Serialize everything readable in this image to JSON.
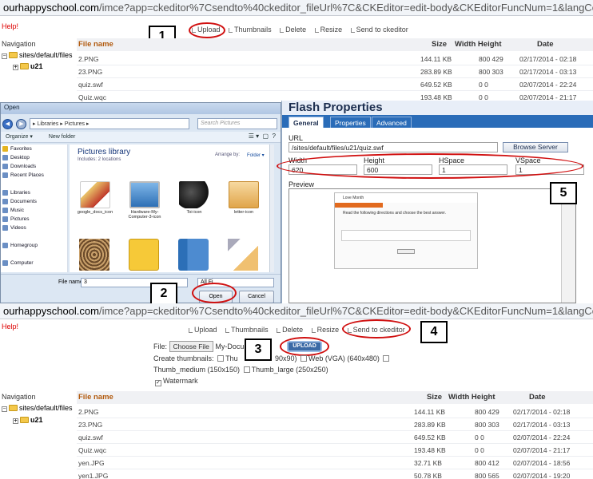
{
  "browser": {
    "host": "ourhappyschool.com",
    "path": "/imce?app=ckeditor%7Csendto%40ckeditor_fileUrl%7C&CKEditor=edit-body&CKEditorFuncNum=1&langCode=en",
    "path_partial": "/imce?app=c",
    "path_tail": "editor%7Csendto%40ckeditor_fileUrl%7C&CKEditor=edit-body&CKEditorFuncNum=1&langCode=en"
  },
  "help": "Help!",
  "toolbar": {
    "upload": "Upload",
    "thumbnails": "Thumbnails",
    "delete": "Delete",
    "resize": "Resize",
    "send": "Send to ckeditor"
  },
  "nav": {
    "title": "Navigation",
    "root": "sites/default/files",
    "sub": "u21"
  },
  "table": {
    "headers": {
      "name": "File name",
      "size": "Size",
      "dims": "Width Height",
      "date": "Date"
    },
    "rows_top": [
      {
        "name": "2.PNG",
        "size": "144.11 KB",
        "dims": "800 429",
        "date": "02/17/2014 - 02:18"
      },
      {
        "name": "23.PNG",
        "size": "283.89 KB",
        "dims": "800 303",
        "date": "02/17/2014 - 03:13"
      },
      {
        "name": "quiz.swf",
        "size": "649.52 KB",
        "dims": "0 0",
        "date": "02/07/2014 - 22:24"
      },
      {
        "name": "Quiz.wqc",
        "size": "193.48 KB",
        "dims": "0 0",
        "date": "02/07/2014 - 21:17"
      }
    ],
    "rows_bottom": [
      {
        "name": "2.PNG",
        "size": "144.11 KB",
        "dims": "800 429",
        "date": "02/17/2014 - 02:18"
      },
      {
        "name": "23.PNG",
        "size": "283.89 KB",
        "dims": "800 303",
        "date": "02/17/2014 - 03:13"
      },
      {
        "name": "quiz.swf",
        "size": "649.52 KB",
        "dims": "0 0",
        "date": "02/07/2014 - 22:24"
      },
      {
        "name": "Quiz.wqc",
        "size": "193.48 KB",
        "dims": "0 0",
        "date": "02/07/2014 - 21:17"
      },
      {
        "name": "yen.JPG",
        "size": "32.71 KB",
        "dims": "800 412",
        "date": "02/07/2014 - 18:56"
      },
      {
        "name": "yen1.JPG",
        "size": "50.78 KB",
        "dims": "800 565",
        "date": "02/07/2014 - 19:20"
      }
    ]
  },
  "callouts": {
    "c1": "1",
    "c2": "2",
    "c3": "3",
    "c4": "4",
    "c5": "5"
  },
  "open_dialog": {
    "title": "Open",
    "breadcrumb": "▸ Libraries ▸ Pictures ▸",
    "search_placeholder": "Search Pictures",
    "organize": "Organize ▾",
    "new_folder": "New folder",
    "left_items": [
      "Favorites",
      "Desktop",
      "Downloads",
      "Recent Places",
      "",
      "Libraries",
      "Documents",
      "Music",
      "Pictures",
      "Videos",
      "",
      "Homegroup",
      "",
      "Computer"
    ],
    "lib_title": "Pictures library",
    "lib_includes": "Includes: 2 locations",
    "arrange": "Arrange by:",
    "arrange_value": "Folder ▾",
    "thumbs": [
      "google_docs_icon",
      "Hardware-My-Computer-3-icon",
      "Toi-icon",
      "letter-icon"
    ],
    "filename_label": "File name:",
    "filename_value": "3",
    "filter": "All Fi",
    "open": "Open",
    "cancel": "Cancel"
  },
  "flash": {
    "title": "Flash Properties",
    "tabs": [
      "General",
      "Properties",
      "Advanced"
    ],
    "url_label": "URL",
    "url_value": "/sites/default/files/u21/quiz.swf",
    "browse": "Browse Server",
    "width_label": "Width",
    "width_value": "620",
    "height_label": "Height",
    "height_value": "600",
    "hspace_label": "HSpace",
    "hspace_value": "1",
    "vspace_label": "VSpace",
    "vspace_value": "1",
    "preview_label": "Preview",
    "preview_title": "Love Month",
    "preview_text": "Read the following directions and choose the best answer."
  },
  "upload_form": {
    "file_label": "File:",
    "choose": "Choose File",
    "chosen": "My-Docur",
    "upload_btn": "UPLOAD",
    "create_thumbs": "Create thumbnails:",
    "thumb_opt1": "Thu",
    "thumb_opt1_tail": "90x90)",
    "web_vga": "Web (VGA) (640x480)",
    "thumb_medium": "Thumb_medium (150x150)",
    "thumb_large": "Thumb_large (250x250)",
    "watermark": "Watermark"
  },
  "colors": {
    "accent": "#b25b0f",
    "ring": "#d01010",
    "flash_tab": "#2a6cb8"
  }
}
